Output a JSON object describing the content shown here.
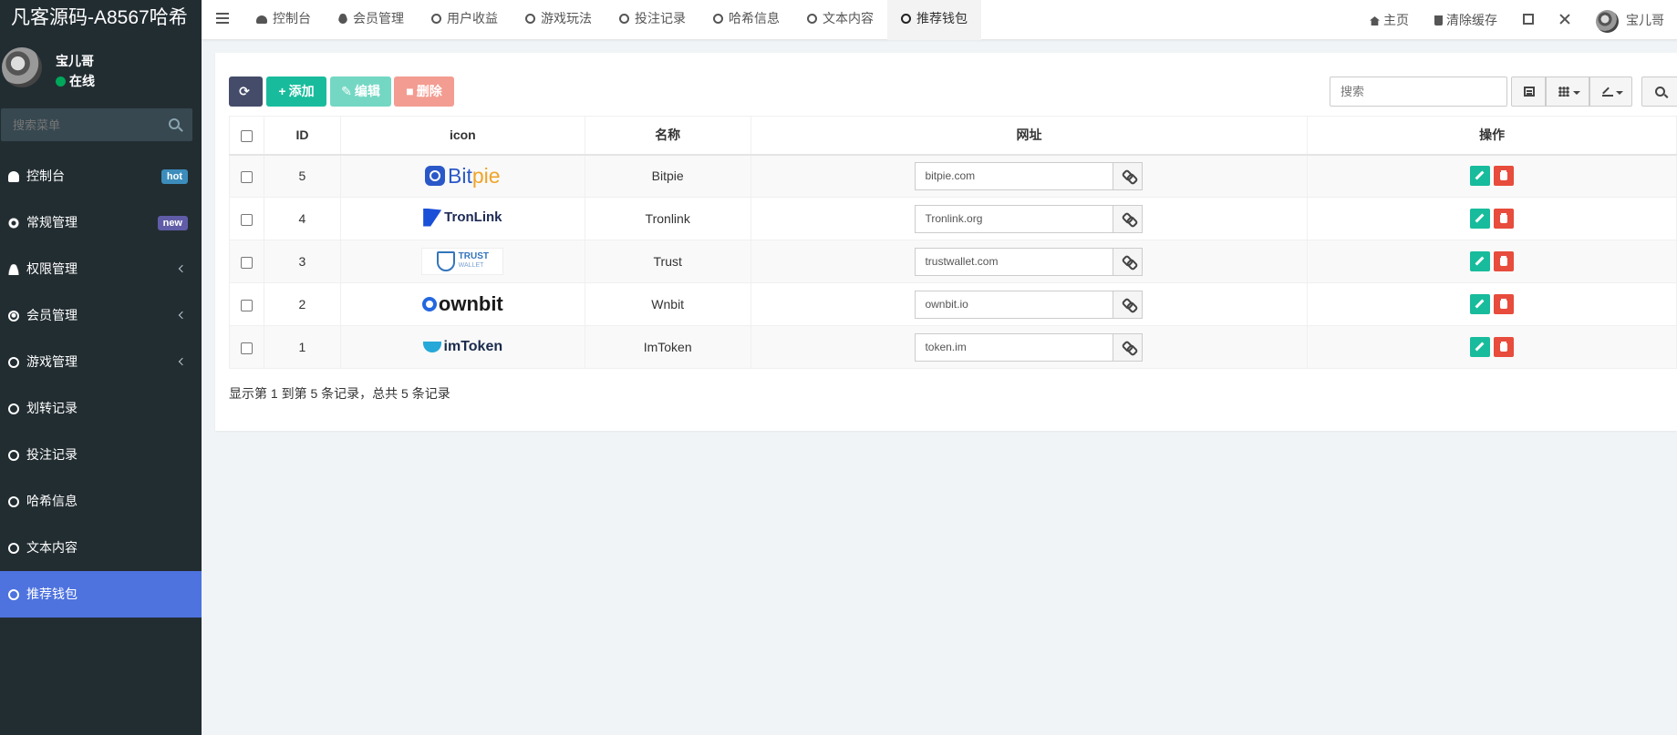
{
  "app": {
    "title": "凡客源码-A8567哈希"
  },
  "user": {
    "name": "宝儿哥",
    "status": "在线"
  },
  "sidebar": {
    "search_placeholder": "搜索菜单",
    "items": [
      {
        "label": "控制台",
        "icon": "dashboard-icon",
        "badge": "hot"
      },
      {
        "label": "常规管理",
        "icon": "cogs-icon",
        "badge": "new"
      },
      {
        "label": "权限管理",
        "icon": "users-icon",
        "chevron": true
      },
      {
        "label": "会员管理",
        "icon": "user-circle-icon",
        "chevron": true
      },
      {
        "label": "游戏管理",
        "icon": "circle-icon",
        "chevron": true
      },
      {
        "label": "划转记录",
        "icon": "circle-icon"
      },
      {
        "label": "投注记录",
        "icon": "circle-icon"
      },
      {
        "label": "哈希信息",
        "icon": "circle-icon"
      },
      {
        "label": "文本内容",
        "icon": "circle-icon"
      },
      {
        "label": "推荐钱包",
        "icon": "circle-icon",
        "active": true
      }
    ]
  },
  "navbar": {
    "tabs": [
      {
        "label": "控制台",
        "icon": "dashboard-icon"
      },
      {
        "label": "会员管理",
        "icon": "user-icon"
      },
      {
        "label": "用户收益",
        "icon": "circle-icon"
      },
      {
        "label": "游戏玩法",
        "icon": "circle-icon"
      },
      {
        "label": "投注记录",
        "icon": "circle-icon"
      },
      {
        "label": "哈希信息",
        "icon": "circle-icon"
      },
      {
        "label": "文本内容",
        "icon": "circle-icon"
      },
      {
        "label": "推荐钱包",
        "icon": "circle-icon",
        "active": true
      }
    ],
    "home_label": "主页",
    "clear_cache_label": "清除缓存",
    "user_name": "宝儿哥"
  },
  "toolbar": {
    "add_label": "添加",
    "edit_label": "编辑",
    "delete_label": "删除",
    "search_placeholder": "搜索"
  },
  "table": {
    "columns": [
      "ID",
      "icon",
      "名称",
      "网址",
      "操作"
    ],
    "rows": [
      {
        "id": "5",
        "logo": "Bitpie",
        "name": "Bitpie",
        "url": "bitpie.com"
      },
      {
        "id": "4",
        "logo": "TronLink",
        "name": "Tronlink",
        "url": "Tronlink.org"
      },
      {
        "id": "3",
        "logo": "TRUST",
        "logo_sub": "WALLET",
        "name": "Trust",
        "url": "trustwallet.com"
      },
      {
        "id": "2",
        "logo": "ownbit",
        "name": "Wnbit",
        "url": "ownbit.io"
      },
      {
        "id": "1",
        "logo": "imToken",
        "name": "ImToken",
        "url": "token.im"
      }
    ]
  },
  "pagination": {
    "summary": "显示第 1 到第 5 条记录，总共 5 条记录"
  },
  "colors": {
    "sidebar_bg": "#222d32",
    "active_menu": "#4e73df",
    "success": "#18bc9c",
    "danger": "#e74c3c",
    "primary_dark": "#444c69"
  }
}
